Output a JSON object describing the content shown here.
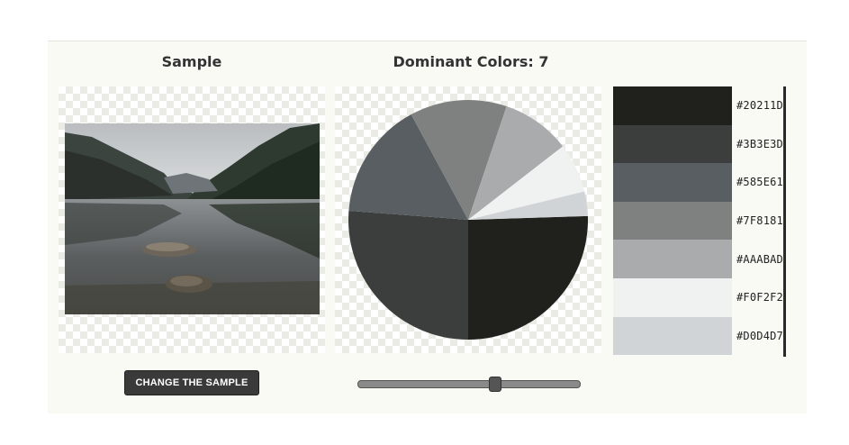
{
  "sample": {
    "heading": "Sample",
    "change_button_label": "CHANGE THE SAMPLE"
  },
  "dominant": {
    "heading": "Dominant Colors: 7",
    "slider_value_fraction": 0.62
  },
  "palette": [
    {
      "hex": "#20211D",
      "label": "#20211D",
      "share": 0.255
    },
    {
      "hex": "#3B3E3D",
      "label": "#3B3E3D",
      "share": 0.262
    },
    {
      "hex": "#585E61",
      "label": "#585E61",
      "share": 0.159
    },
    {
      "hex": "#7F8181",
      "label": "#7F8181",
      "share": 0.131
    },
    {
      "hex": "#AAABAD",
      "label": "#AAABAD",
      "share": 0.093
    },
    {
      "hex": "#F0F2F2",
      "label": "#F0F2F2",
      "share": 0.067
    },
    {
      "hex": "#D0D4D7",
      "label": "#D0D4D7",
      "share": 0.033
    }
  ],
  "chart_data": {
    "type": "pie",
    "slices": [
      {
        "name": "#20211D",
        "value": 0.255
      },
      {
        "name": "#3B3E3D",
        "value": 0.262
      },
      {
        "name": "#585E61",
        "value": 0.159
      },
      {
        "name": "#7F8181",
        "value": 0.131
      },
      {
        "name": "#AAABAD",
        "value": 0.093
      },
      {
        "name": "#F0F2F2",
        "value": 0.067
      },
      {
        "name": "#D0D4D7",
        "value": 0.033
      }
    ]
  }
}
